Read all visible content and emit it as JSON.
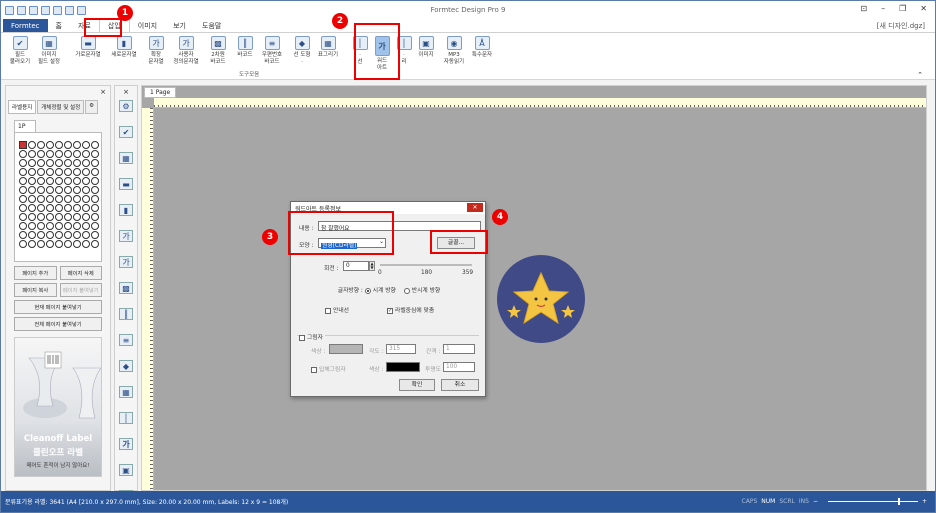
{
  "app": {
    "title": "Formtec Design Pro 9",
    "doc_name": "[새 디자인.dgz]"
  },
  "tabs": [
    "Formtec",
    "홈",
    "자료",
    "삽입",
    "이미지",
    "보기",
    "도움말"
  ],
  "ribbon": {
    "buttons": [
      {
        "label": "필드\n불러오기",
        "icon": "field-load-icon",
        "glyph": "✔"
      },
      {
        "label": "이미지\n필드 설정",
        "icon": "image-field-icon",
        "glyph": "▦"
      },
      {
        "label": "가로문자열",
        "icon": "horizontal-text-icon",
        "glyph": "▬"
      },
      {
        "label": "세로문자열",
        "icon": "vertical-text-icon",
        "glyph": "▮"
      },
      {
        "label": "확장\n문자열",
        "icon": "extended-text-icon",
        "glyph": "가"
      },
      {
        "label": "사용자\n정의문자열",
        "icon": "custom-text-icon",
        "glyph": "가"
      },
      {
        "label": "2차원\n바코드",
        "icon": "qr-code-icon",
        "glyph": "▩"
      },
      {
        "label": "바코드",
        "icon": "barcode-icon",
        "glyph": "║"
      },
      {
        "label": "우편번호\n바코드",
        "icon": "postal-barcode-icon",
        "glyph": "≡"
      },
      {
        "label": "선 도형\n·",
        "icon": "shape-icon",
        "glyph": "◆"
      },
      {
        "label": "표그리기",
        "icon": "table-icon",
        "glyph": "▦"
      },
      {
        "label": "·\n선",
        "icon": "line-icon",
        "glyph": "│"
      },
      {
        "label": "워드\n아트",
        "icon": "wordart-icon",
        "glyph": "가"
      },
      {
        "label": "·\n리",
        "icon": "divider-icon",
        "glyph": "│"
      },
      {
        "label": "이미지",
        "icon": "image-icon",
        "glyph": "▣"
      },
      {
        "label": "MP3\n자동읽기",
        "icon": "mp3-icon",
        "glyph": "◉"
      },
      {
        "label": "특수문자",
        "icon": "special-char-icon",
        "glyph": "Å"
      }
    ],
    "group_label": "도구모음"
  },
  "badges": [
    "1",
    "2",
    "3",
    "4"
  ],
  "left_panel": {
    "tabs": [
      "라벨용지",
      "개체정렬 및 설정"
    ],
    "page_tab": "1P",
    "buttons": [
      "페이지 추가",
      "페이지 삭제",
      "페이지 복사",
      "페이지 붙여넣기",
      "현재 페이지 붙여넣기",
      "전체 페이지 붙여넣기"
    ],
    "ad": {
      "brand": "Cleanoff Label",
      "title": "클린오프 라벨",
      "caption": "떼어도 흔적이 남지 않아요!"
    }
  },
  "document": {
    "tab": "1 Page"
  },
  "dialog": {
    "title": "워드아트 등록정보",
    "content_label": "내용 :",
    "content_value": "참 잘했어요",
    "shape_label": "모양 :",
    "shape_value": "원형(CD라벨)",
    "font_button": "글꼴...",
    "rotate_label": "회전 :",
    "rotate_value": "0",
    "scale": [
      "0",
      "180",
      "359"
    ],
    "direction_label": "글자방향 :",
    "dir_cw": "시계 방향",
    "dir_ccw": "반시계 방향",
    "guide_label": "안내선",
    "center_label": "라벨중심에 맞춤",
    "shadow_label": "그림자",
    "color_label": "색상 :",
    "angle_label": "각도 :",
    "angle_value": "315",
    "gap_label": "간격 :",
    "gap_value": "1",
    "solid_shadow_label": "입체그림자",
    "color2_label": "색상 :",
    "opacity_label": "투명도 :",
    "opacity_value": "100",
    "ok": "확인",
    "cancel": "취소"
  },
  "status": {
    "left": "분류표기용 라벨: 3641 (A4 [210.0 x 297.0 mm], Size: 20.00 x 20.00 mm,  Labels: 12 x 9 = 108개)",
    "caps": "CAPS",
    "num": "NUM",
    "scrl": "SCRL",
    "ins": "INS"
  }
}
